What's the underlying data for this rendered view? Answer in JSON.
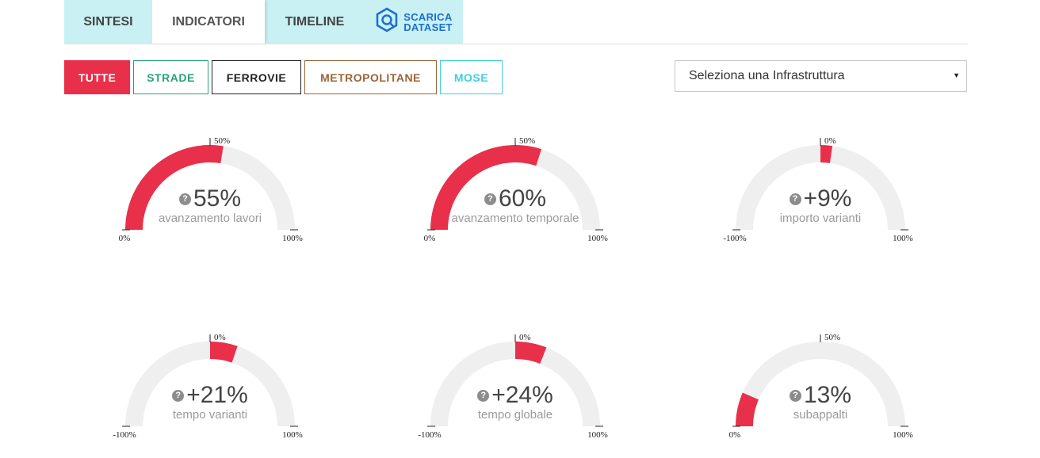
{
  "tabs": [
    {
      "label": "SINTESI"
    },
    {
      "label": "INDICATORI"
    },
    {
      "label": "TIMELINE"
    },
    {
      "label_line1": "SCARICA",
      "label_line2": "DATASET"
    }
  ],
  "filters": [
    {
      "label": "TUTTE",
      "color": "#e8304a"
    },
    {
      "label": "STRADE",
      "color": "#27a37a"
    },
    {
      "label": "FERROVIE",
      "color": "#222222"
    },
    {
      "label": "METROPOLITANE",
      "color": "#9a6438"
    },
    {
      "label": "MOSE",
      "color": "#3dd0e0"
    }
  ],
  "select": {
    "placeholder": "Seleziona una Infrastruttura"
  },
  "colors": {
    "accent": "#e8304a",
    "track": "#efefef",
    "tab_bg": "#c9f1f4",
    "download": "#1a6fd0"
  },
  "gauges": [
    {
      "value": "55%",
      "label": "avanzamento lavori",
      "min_label": "0%",
      "mid_label": "50%",
      "max_label": "100%",
      "fill_from": 0.0,
      "fill_to": 0.55
    },
    {
      "value": "60%",
      "label": "avanzamento temporale",
      "min_label": "0%",
      "mid_label": "50%",
      "max_label": "100%",
      "fill_from": 0.0,
      "fill_to": 0.6
    },
    {
      "value": "+9%",
      "label": "importo varianti",
      "min_label": "-100%",
      "mid_label": "0%",
      "max_label": "100%",
      "fill_from": 0.5,
      "fill_to": 0.545
    },
    {
      "value": "+21%",
      "label": "tempo varianti",
      "min_label": "-100%",
      "mid_label": "0%",
      "max_label": "100%",
      "fill_from": 0.5,
      "fill_to": 0.605
    },
    {
      "value": "+24%",
      "label": "tempo globale",
      "min_label": "-100%",
      "mid_label": "0%",
      "max_label": "100%",
      "fill_from": 0.5,
      "fill_to": 0.62
    },
    {
      "value": "13%",
      "label": "subappalti",
      "min_label": "0%",
      "mid_label": "50%",
      "max_label": "100%",
      "fill_from": 0.0,
      "fill_to": 0.13
    }
  ]
}
